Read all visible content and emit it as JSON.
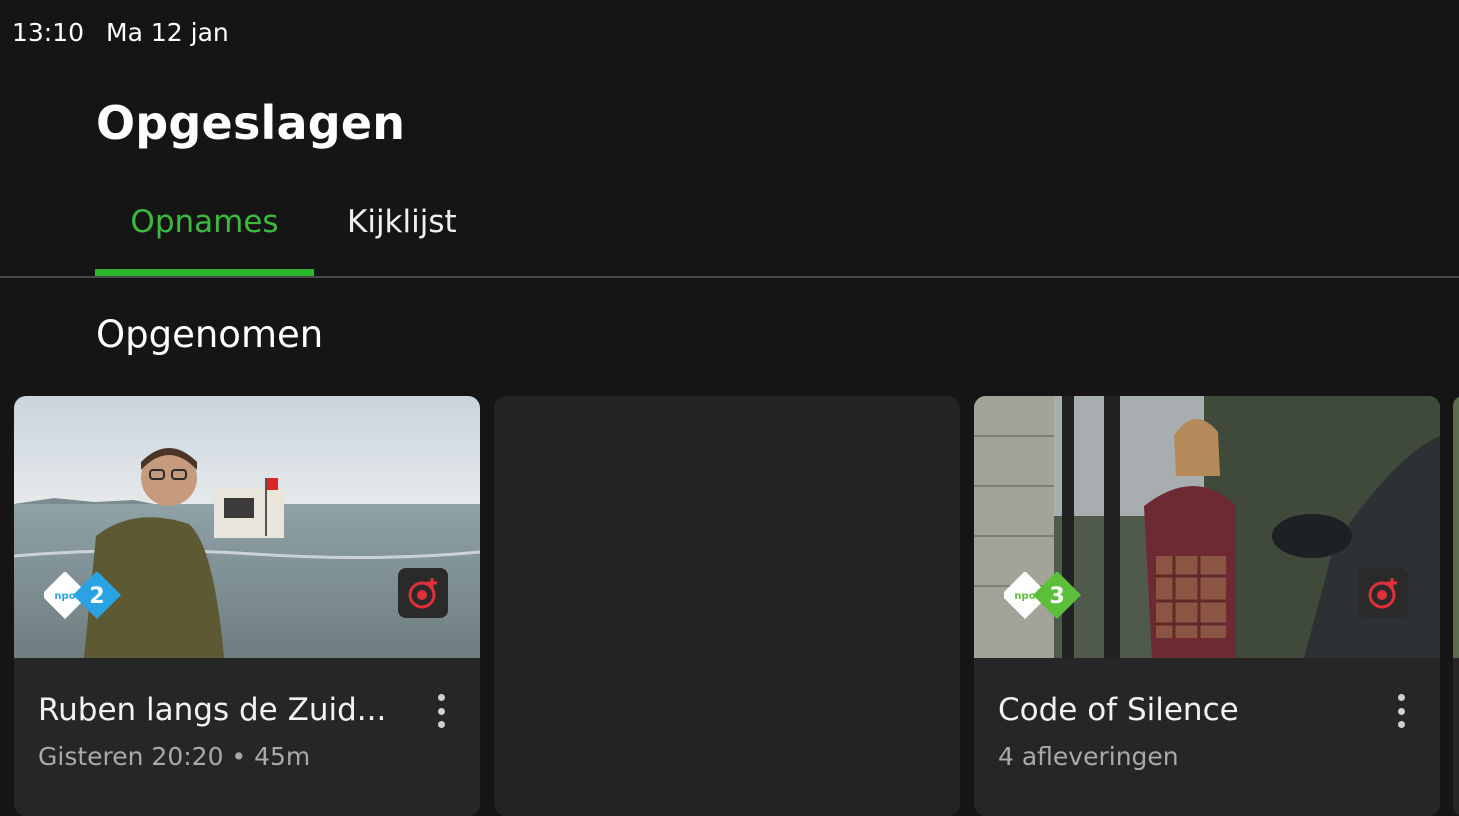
{
  "status_bar": {
    "time": "13:10",
    "date": "Ma 12 jan"
  },
  "header": {
    "title": "Opgeslagen"
  },
  "tabs": [
    {
      "label": "Opnames",
      "active": true
    },
    {
      "label": "Kijklijst",
      "active": false
    }
  ],
  "section": {
    "title": "Opgenomen"
  },
  "cards": [
    {
      "title": "Ruben langs de Zuid...",
      "subtitle": "Gisteren 20:20 • 45m",
      "channel_logo_text": "npo 2",
      "icons": [
        "npo2-logo-icon",
        "record-icon",
        "more-vertical-icon"
      ]
    },
    {
      "title": "",
      "subtitle": ""
    },
    {
      "title": "Code of Silence",
      "subtitle": "4 afleveringen",
      "channel_logo_text": "npo 3",
      "icons": [
        "npo3-logo-icon",
        "record-icon",
        "more-vertical-icon"
      ]
    }
  ],
  "colors": {
    "background": "#151515",
    "card": "#262626",
    "accent_green": "#2db52d",
    "npo2_blue": "#29a3e3",
    "npo3_green": "#5cbf3a",
    "record_red": "#e0303a"
  }
}
